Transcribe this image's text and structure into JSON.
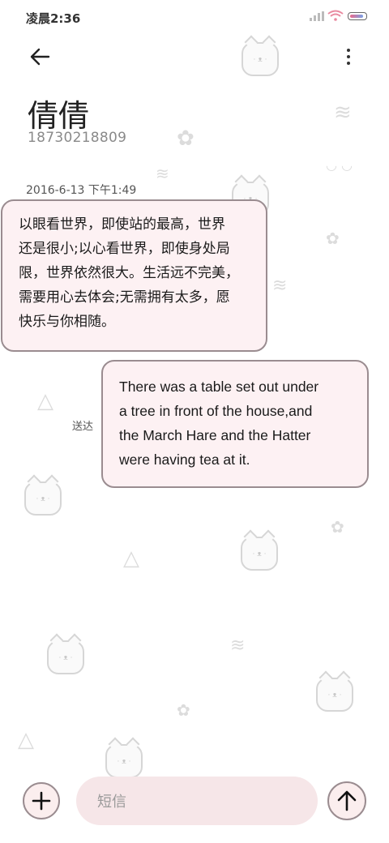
{
  "status_bar": {
    "time": "凌晨2:36",
    "icons": [
      "signal-icon",
      "wifi-icon",
      "battery-icon"
    ]
  },
  "header": {
    "back_icon": "arrow-left-icon",
    "menu_icon": "more-vertical-icon",
    "contact_name": "倩倩",
    "phone_number": "18730218809"
  },
  "conversation": {
    "timestamp": "2016-6-13 下午1:49",
    "received_message": {
      "lines": [
        "以眼看世界，即使站的最高，世界",
        "还是很小;以心看世界，即使身处局",
        "限，世界依然很大。生活远不完美，",
        "需要用心去体会;无需拥有太多，愿",
        "快乐与你相随。"
      ]
    },
    "sent_message": {
      "lines": [
        "There was a table set out under",
        "a tree in front of the house,and",
        "the March Hare and the Hatter",
        "were having tea at it."
      ],
      "status": "送达"
    }
  },
  "composer": {
    "add_icon": "plus-icon",
    "placeholder": "短信",
    "value": "",
    "send_icon": "arrow-up-icon"
  },
  "colors": {
    "bubble_fill": "#fdf1f3",
    "bubble_border": "#9a8c90",
    "input_fill": "#f6e6e8"
  }
}
